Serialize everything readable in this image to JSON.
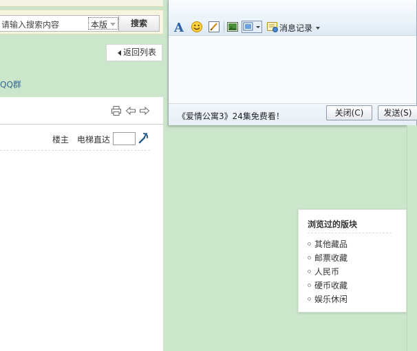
{
  "search": {
    "placeholder": "请输入搜索内容",
    "scope": "本版",
    "button": "搜索"
  },
  "nav": {
    "back_label": "返回列表",
    "qq_link": "QQ群"
  },
  "post": {
    "toolbar_icons": [
      "print-icon",
      "prev-thread-icon",
      "next-thread-icon"
    ],
    "author_label": "楼主",
    "elevator_label": "电梯直达",
    "floor_value": ""
  },
  "chat": {
    "toolbar": {
      "icons": [
        "font-icon",
        "emoji-icon",
        "pen-icon",
        "image-icon",
        "screenshot-icon",
        "history-icon"
      ],
      "history_label": "消息记录"
    },
    "promo_text": "《爱情公寓3》24集免费看！",
    "close_label": "关闭(C)",
    "send_label": "发送(S)"
  },
  "browsed": {
    "title": "浏览过的版块",
    "items": [
      "其他藏品",
      "邮票收藏",
      "人民币",
      "硬币收藏",
      "娱乐休闲"
    ]
  },
  "colors": {
    "page_bg": "#cce6cc",
    "link": "#336699",
    "chat_bg": "#f6f9fc"
  }
}
